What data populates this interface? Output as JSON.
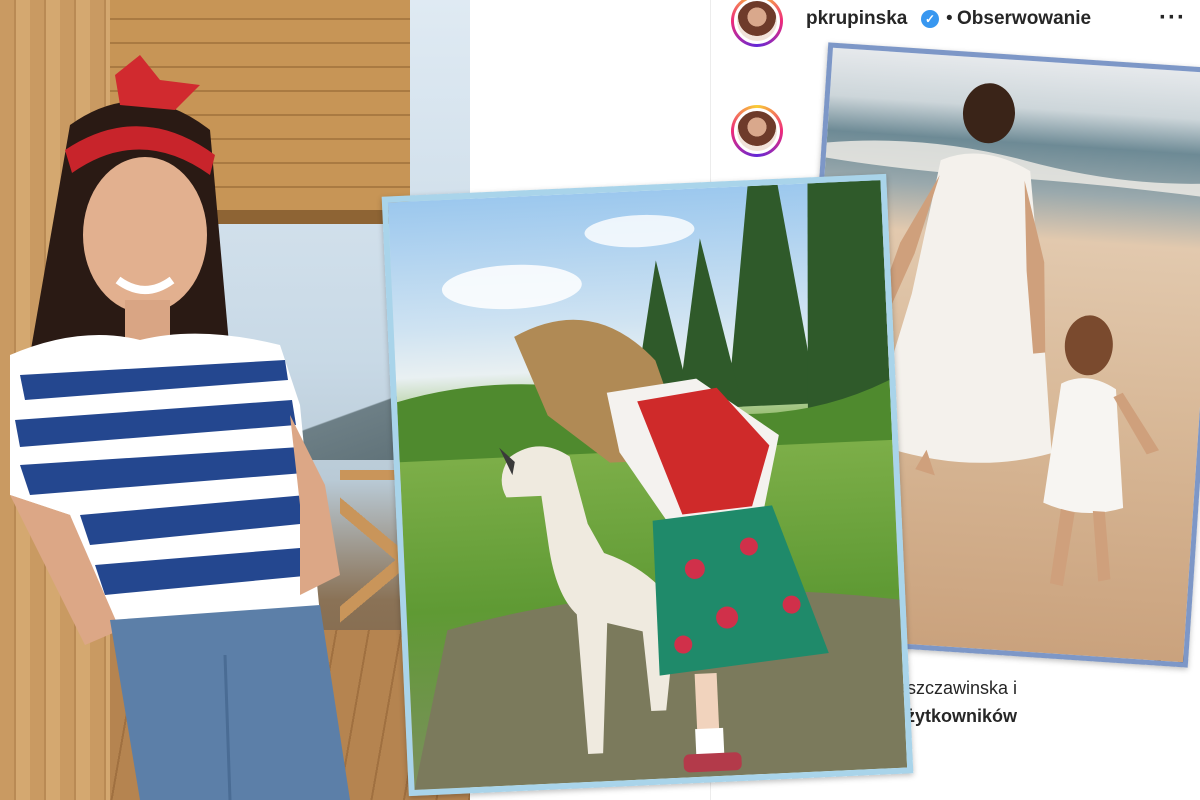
{
  "profile": {
    "username": "pkrupinska",
    "verified_icon": "verified-badge-icon",
    "separator": "•",
    "follow_status": "Obserwowanie",
    "more_icon": "more-options-icon"
  },
  "post": {
    "liked_by_line1": "ilaszczawinska i",
    "liked_by_line2": "h użytkowników",
    "bookmark_icon": "bookmark-icon"
  },
  "colors": {
    "ig_text": "#262626",
    "verified_blue": "#3897f0",
    "frame_mid": "#a9d4ea",
    "frame_right": "#7d97c7"
  },
  "photos": [
    {
      "subject": "woman in striped top on wooden balcony"
    },
    {
      "subject": "girl in folk costume petting white dog in forest meadow"
    },
    {
      "subject": "woman and girl in white dresses walking on beach"
    }
  ]
}
